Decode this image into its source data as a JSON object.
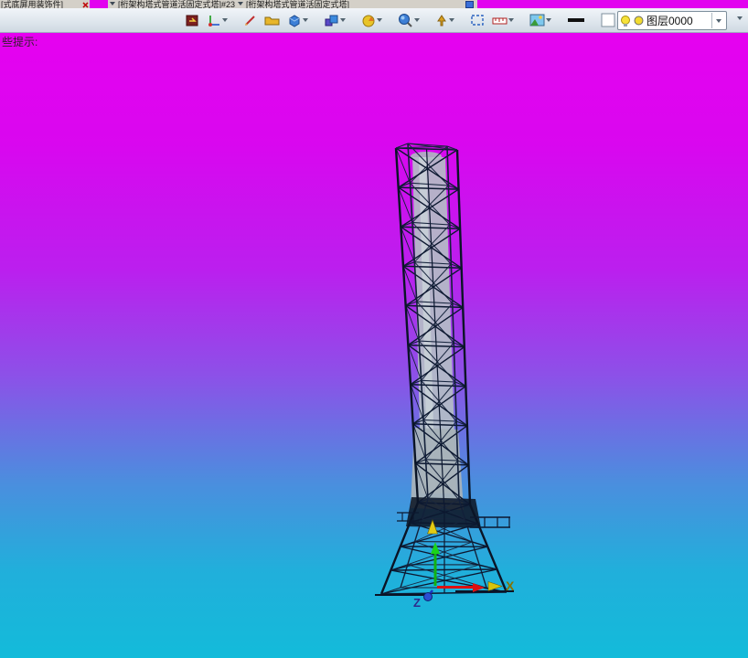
{
  "tabs": {
    "tab1": "[式底屏用装饰件]",
    "tab2": "[桁架构塔式管道活固定式塔]#23",
    "tab3": "[桁架构塔式管道活固定式塔]"
  },
  "toolbar": {
    "icons": [
      "return-board-icon",
      "coordinate-axes-icon",
      "sketch-pen-icon",
      "part-folder-icon",
      "solid-cube-icon",
      "assembly-cubes-icon",
      "section-pie-icon",
      "render-sphere-icon",
      "marker-pin-icon",
      "window-select-icon",
      "ruler-icon",
      "scene-image-icon",
      "line-width-icon",
      "color-swatch-icon",
      "material-sphere-icon"
    ],
    "layer_combo": {
      "value": "图层0000",
      "icons": [
        "bulb-icon",
        "layer-color-icon"
      ]
    }
  },
  "viewport": {
    "hint": "些提示:",
    "axes": {
      "x": "X",
      "z": "Z"
    },
    "background": {
      "top": "#e601f0",
      "bottom": "#13bbda"
    },
    "model": "lattice-tower-3d"
  }
}
